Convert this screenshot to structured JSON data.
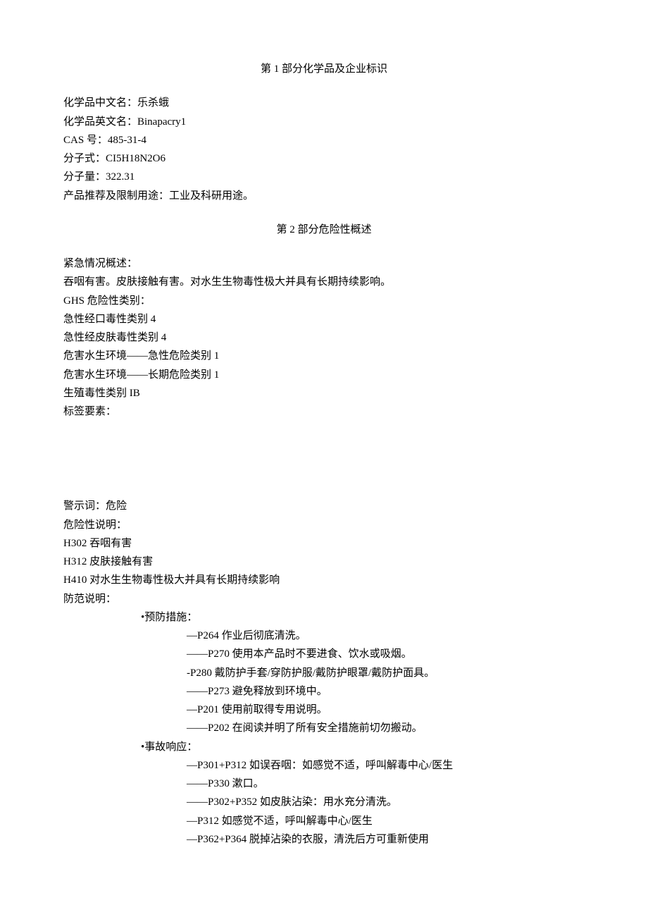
{
  "section1": {
    "title": "第 1 部分化学品及企业标识",
    "lines": [
      "化学品中文名：乐杀蛾",
      "化学品英文名：Binapacry1",
      "CAS 号：485-31-4",
      "分子式：CI5H18N2O6",
      "分子量：322.31",
      "产品推荐及限制用途：工业及科研用途。"
    ]
  },
  "section2": {
    "title": "第 2 部分危险性概述",
    "lines_a": [
      "紧急情况概述：",
      "吞咽有害。皮肤接触有害。对水生生物毒性极大并具有长期持续影响。",
      "GHS 危险性类别：",
      "急性经口毒性类别 4",
      "急性经皮肤毒性类别 4",
      "危害水生环境——急性危险类别 1",
      "危害水生环境——长期危险类别 1",
      "生殖毒性类别 IB",
      "标签要素："
    ],
    "lines_b": [
      "警示词：危险",
      "危险性说明：",
      "H302 吞咽有害",
      "H312 皮肤接触有害",
      "H410 对水生生物毒性极大并具有长期持续影响",
      "防范说明："
    ],
    "groups": [
      {
        "heading": "•预防措施：",
        "items": [
          "—P264 作业后彻底清洗。",
          "——P270 使用本产品时不要进食、饮水或吸烟。",
          "-P280 戴防护手套/穿防护服/戴防护眼罩/戴防护面具。",
          "——P273 避免释放到环境中。",
          "—P201 使用前取得专用说明。",
          "——P202 在阅读并明了所有安全措施前切勿搬动。"
        ]
      },
      {
        "heading": "•事故响应：",
        "items": [
          "—P301+P312 如误吞咽：如感觉不适，呼叫解毒中心/医生",
          "——P330 漱口。",
          "——P302+P352 如皮肤沾染：用水充分清洗。",
          "—P312 如感觉不适，呼叫解毒中心/医生",
          "—P362+P364 脱掉沾染的衣服，清洗后方可重新使用"
        ]
      }
    ]
  }
}
